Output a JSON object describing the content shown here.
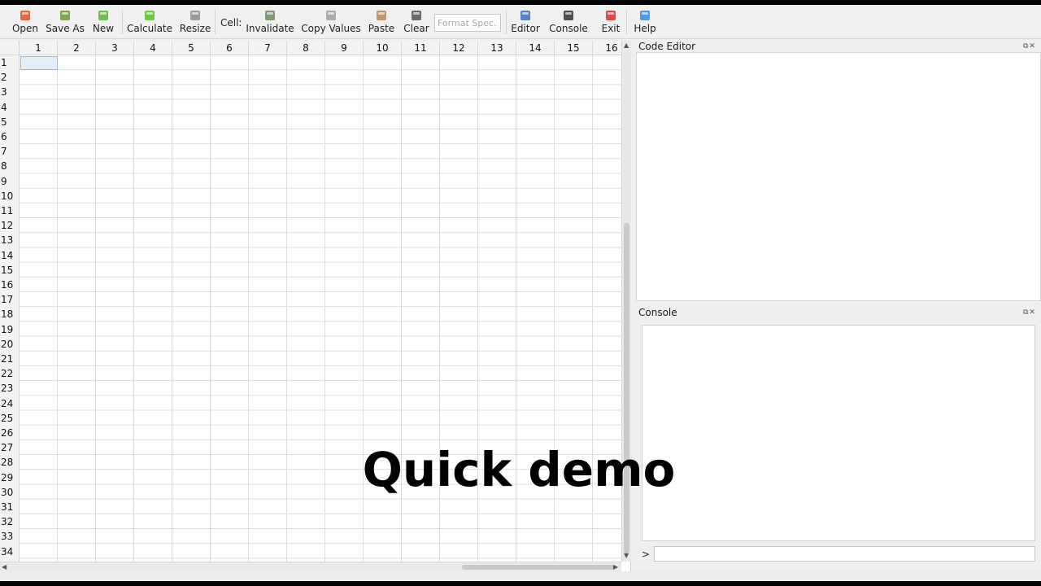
{
  "toolbar": {
    "buttons": [
      {
        "label": "Open",
        "icon": "open-folder-icon",
        "color": "#d9542b"
      },
      {
        "label": "Save As",
        "icon": "save-as-icon",
        "color": "#6a9a3a"
      },
      {
        "label": "New",
        "icon": "new-file-icon",
        "color": "#5fb03b"
      },
      {
        "label": "Calculate",
        "icon": "play-icon",
        "color": "#5cbf2a"
      },
      {
        "label": "Resize",
        "icon": "resize-grid-icon",
        "color": "#8c8c8c"
      },
      {
        "label": "Invalidate",
        "icon": "invalidate-icon",
        "color": "#6a8a5a"
      },
      {
        "label": "Copy Values",
        "icon": "copy-icon",
        "color": "#a0a0a0"
      },
      {
        "label": "Paste",
        "icon": "clipboard-icon",
        "color": "#b08a5a"
      },
      {
        "label": "Clear",
        "icon": "clear-icon",
        "color": "#555555"
      },
      {
        "label": "Editor",
        "icon": "edit-icon",
        "color": "#3a6fb0"
      },
      {
        "label": "Console",
        "icon": "terminal-icon",
        "color": "#333333"
      },
      {
        "label": "Exit",
        "icon": "power-icon",
        "color": "#d03030"
      },
      {
        "label": "Help",
        "icon": "help-icon",
        "color": "#3a8ad0"
      }
    ],
    "cell_label": "Cell:",
    "format_placeholder": "Format Spec..."
  },
  "sheet": {
    "columns": [
      "1",
      "2",
      "3",
      "4",
      "5",
      "6",
      "7",
      "8",
      "9",
      "10",
      "11",
      "12",
      "13",
      "14",
      "15",
      "16"
    ],
    "rows": [
      "1",
      "2",
      "3",
      "4",
      "5",
      "6",
      "7",
      "8",
      "9",
      "10",
      "11",
      "12",
      "13",
      "14",
      "15",
      "16",
      "17",
      "18",
      "19",
      "20",
      "21",
      "22",
      "23",
      "24",
      "25",
      "26",
      "27",
      "28",
      "29",
      "30",
      "31",
      "32",
      "33",
      "34"
    ]
  },
  "code_editor": {
    "title": "Code Editor"
  },
  "console": {
    "title": "Console",
    "prompt": ">"
  },
  "overlay": {
    "caption": "Quick demo"
  }
}
